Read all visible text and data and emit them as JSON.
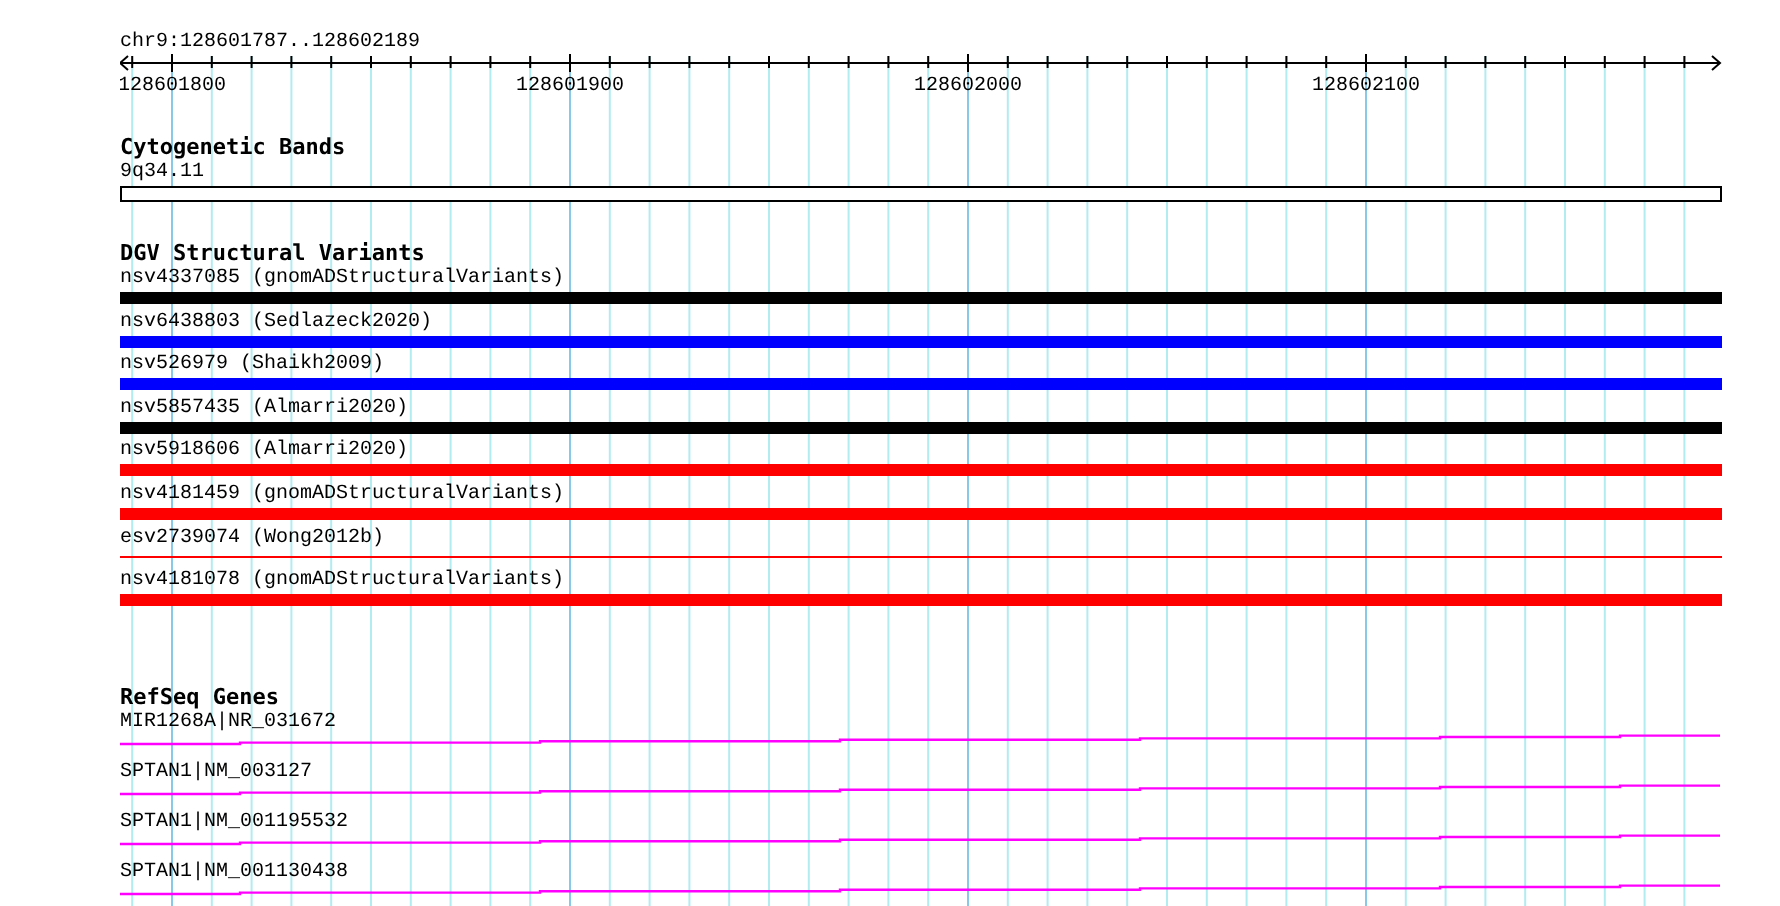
{
  "ruler": {
    "location": "chr9:128601787..128602189",
    "tick_labels": [
      "128601800",
      "128601900",
      "128602000",
      "128602100"
    ]
  },
  "tracks": [
    {
      "title": "Cytogenetic Bands",
      "kind": "band",
      "features": [
        {
          "label": "9q34.11",
          "kind": "box",
          "color": "#ffffff"
        }
      ]
    },
    {
      "title": "DGV Structural Variants",
      "kind": "variants",
      "features": [
        {
          "label": "nsv4337085 (gnomADStructuralVariants)",
          "kind": "bar",
          "color": "#000000"
        },
        {
          "label": "nsv6438803 (Sedlazeck2020)",
          "kind": "bar",
          "color": "#0000ff"
        },
        {
          "label": "nsv526979 (Shaikh2009)",
          "kind": "bar",
          "color": "#0000ff"
        },
        {
          "label": "nsv5857435 (Almarri2020)",
          "kind": "bar",
          "color": "#000000"
        },
        {
          "label": "nsv5918606 (Almarri2020)",
          "kind": "bar",
          "color": "#ff0000"
        },
        {
          "label": "nsv4181459 (gnomADStructuralVariants)",
          "kind": "bar",
          "color": "#ff0000"
        },
        {
          "label": "esv2739074 (Wong2012b)",
          "kind": "line",
          "color": "#ff0000"
        },
        {
          "label": "nsv4181078 (gnomADStructuralVariants)",
          "kind": "bar",
          "color": "#ff0000"
        }
      ]
    },
    {
      "title": "RefSeq Genes",
      "kind": "genes",
      "features": [
        {
          "label": "MIR1268A|NR_031672",
          "kind": "transcript",
          "color": "#ff00ff"
        },
        {
          "label": "SPTAN1|NM_003127",
          "kind": "transcript",
          "color": "#ff00ff"
        },
        {
          "label": "SPTAN1|NM_001195532",
          "kind": "transcript",
          "color": "#ff00ff"
        },
        {
          "label": "SPTAN1|NM_001130438",
          "kind": "transcript",
          "color": "#ff00ff"
        }
      ]
    }
  ]
}
